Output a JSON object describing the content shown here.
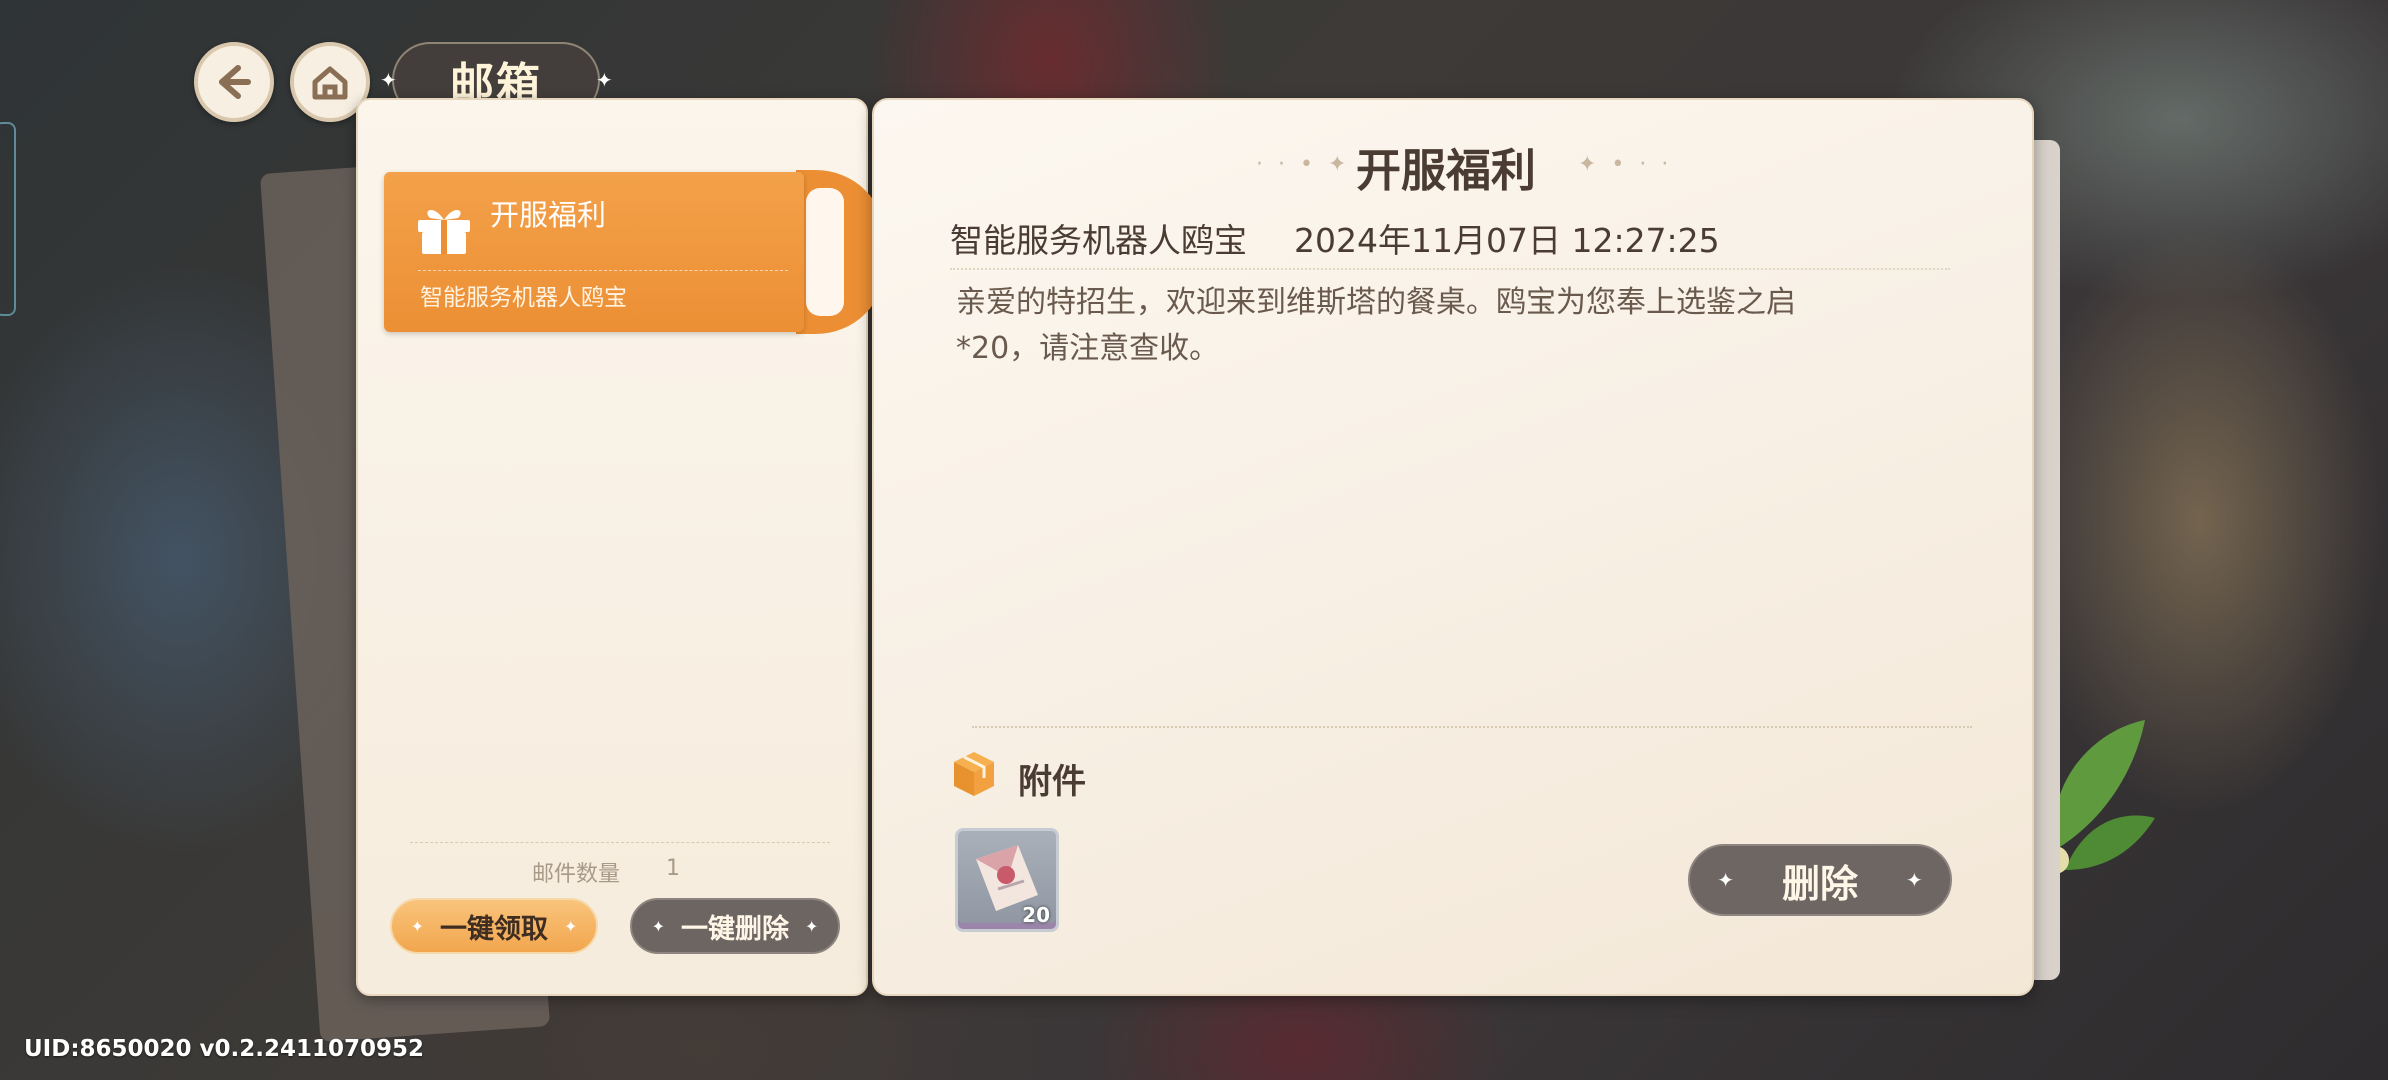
{
  "header": {
    "title": "邮箱",
    "back_icon": "arrow-left-icon",
    "home_icon": "home-icon"
  },
  "mail_list": {
    "items": [
      {
        "title": "开服福利",
        "sender": "智能服务机器人鸥宝",
        "icon": "gift-icon",
        "selected": true
      }
    ],
    "count_label": "邮件数量",
    "count_value": "1",
    "claim_all_label": "一键领取",
    "delete_all_label": "一键删除"
  },
  "mail_detail": {
    "title": "开服福利",
    "sender": "智能服务机器人鸥宝",
    "date": "2024年11月07日 12:27:25",
    "body_line1": "亲爱的特招生，欢迎来到维斯塔的餐桌。鸥宝为您奉上选鉴之启",
    "body_line2": "*20，请注意查收。",
    "attachments_label": "附件",
    "attachments": [
      {
        "icon": "envelope-item-icon",
        "quantity": "20"
      }
    ],
    "delete_label": "删除"
  },
  "footer": {
    "uid_text": "UID:8650020  v0.2.2411070952"
  },
  "colors": {
    "accent_orange": "#f0963a",
    "dark_button": "#6e6662",
    "card_bg": "#fbf5ec",
    "text_dark": "#4a3c32"
  }
}
